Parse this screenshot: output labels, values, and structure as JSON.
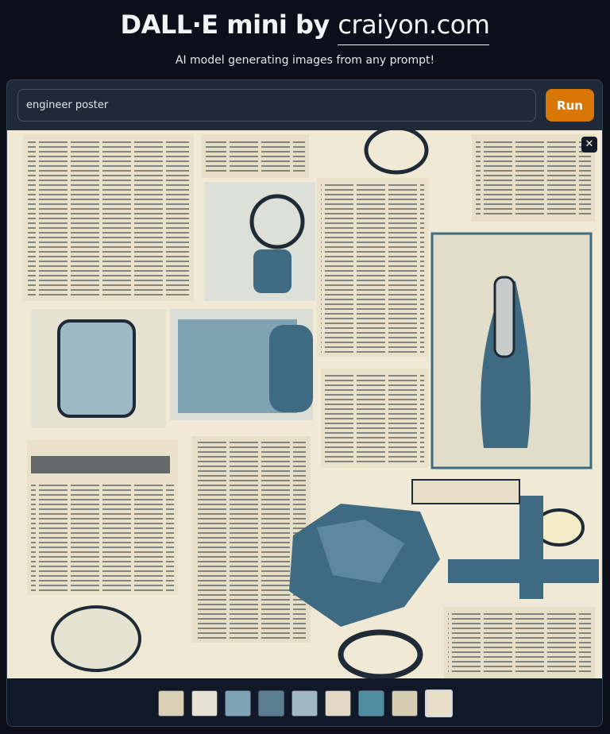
{
  "header": {
    "title_prefix": "DALL·E mini by ",
    "title_link": "craiyon.com",
    "subtitle": "AI model generating images from any prompt!"
  },
  "prompt": {
    "value": "engineer poster"
  },
  "run_label": "Run",
  "gallery": {
    "close_icon": "close-icon",
    "image_description": "collage of vintage newspaper clippings and engineering tools",
    "palette": {
      "paper": "#efe9d6",
      "ink": "#1e2a35",
      "blue": "#3e6a82"
    }
  },
  "thumbnails": [
    {
      "name": "thumb-1",
      "bg": "#d8cfb4"
    },
    {
      "name": "thumb-2",
      "bg": "#e6e1d3"
    },
    {
      "name": "thumb-3",
      "bg": "#7fa3b5"
    },
    {
      "name": "thumb-4",
      "bg": "#5a7d8f"
    },
    {
      "name": "thumb-5",
      "bg": "#9fb8c4"
    },
    {
      "name": "thumb-6",
      "bg": "#e0d8c5"
    },
    {
      "name": "thumb-7",
      "bg": "#4f8ea0"
    },
    {
      "name": "thumb-8",
      "bg": "#d6cdb2"
    },
    {
      "name": "thumb-9",
      "bg": "#e7dfc8",
      "selected": true
    }
  ],
  "colors": {
    "background": "#0b0f19",
    "panel": "#1f2937",
    "accent": "#d97706"
  }
}
